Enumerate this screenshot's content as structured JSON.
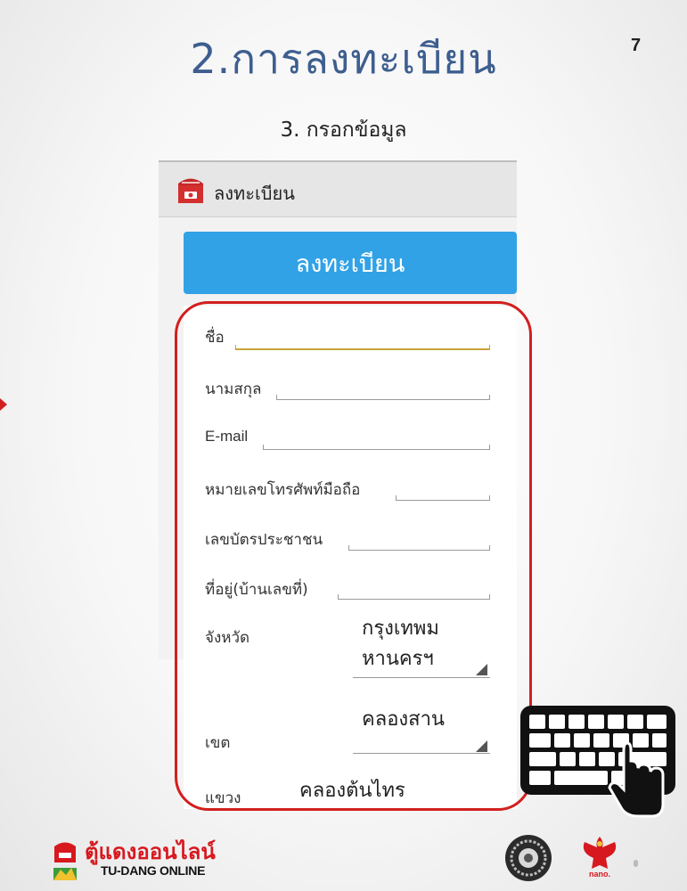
{
  "slide": {
    "title": "2.การลงทะเบียน",
    "page_number": "7",
    "step_caption": "3. กรอกข้อมูล"
  },
  "app": {
    "bar_title": "ลงทะเบียน",
    "bar_icon": "red-mailbox-icon",
    "register_button_label": "ลงทะเบียน",
    "accent_color": "#31a2e6"
  },
  "form": {
    "first_name_label": "ชื่อ",
    "last_name_label": "นามสกุล",
    "email_label": "E-mail",
    "phone_label": "หมายเลขโทรศัพท์มือถือ",
    "id_card_label": "เลขบัตรประชาชน",
    "address_label": "ที่อยู่(บ้านเลขที่)",
    "province_label": "จังหวัด",
    "province_value_line1": "กรุงเทพม",
    "province_value_line2": "หานครฯ",
    "district_label": "เขต",
    "district_value": "คลองสาน",
    "subdistrict_label": "แขวง",
    "subdistrict_value": "คลองต้นไทร"
  },
  "branding": {
    "name_thai": "ตู้แดงออนไลน์",
    "name_english": "TU-DANG ONLINE",
    "agency_caption": "nano.",
    "brand_color": "#d7181f"
  },
  "decorations": {
    "highlight_color": "#d21f1f",
    "keyboard_icon": "keyboard-with-pointer-hand-icon"
  }
}
